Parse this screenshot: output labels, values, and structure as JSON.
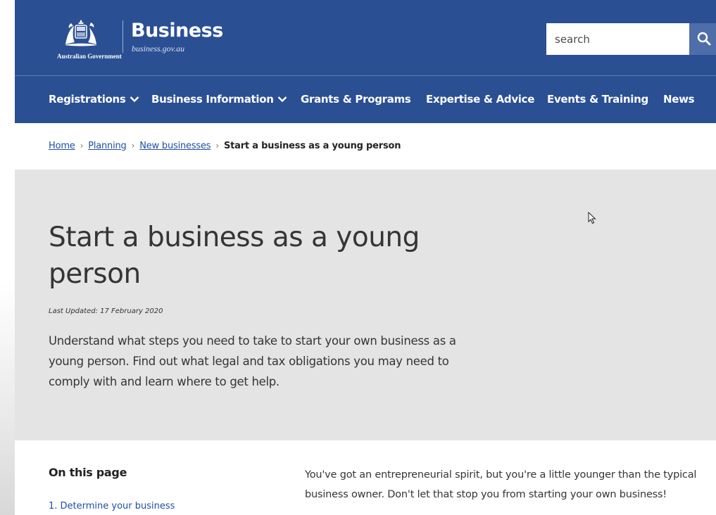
{
  "header": {
    "government_label": "Australian Government",
    "brand_title": "Business",
    "brand_url": "business.gov.au",
    "search_placeholder": "search"
  },
  "nav": {
    "items": [
      {
        "label": "Registrations",
        "dropdown": true
      },
      {
        "label": "Business Information",
        "dropdown": true
      },
      {
        "label": "Grants & Programs",
        "dropdown": false
      },
      {
        "label": "Expertise & Advice",
        "dropdown": false
      },
      {
        "label": "Events & Training",
        "dropdown": false
      },
      {
        "label": "News",
        "dropdown": false
      }
    ]
  },
  "breadcrumb": {
    "items": [
      "Home",
      "Planning",
      "New businesses"
    ],
    "current": "Start a business as a young person",
    "separator": "›"
  },
  "hero": {
    "title": "Start a business as a young person",
    "last_updated": "Last Updated: 17 February 2020",
    "intro": "Understand what steps you need to take to start your own business as a young person. Find out what legal and tax obligations you may need to comply with and learn where to get help."
  },
  "toc": {
    "title": "On this page",
    "items": [
      "1. Determine your business"
    ]
  },
  "body": {
    "paragraph": "You've got an entrepreneurial spirit, but you're a little younger than the typical business owner. Don't let that stop you from starting your own business!"
  },
  "colors": {
    "header_bg": "#2a4f93",
    "search_button_bg": "#4e6ea9",
    "hero_bg": "#e4e4e4",
    "link": "#1f4fa3"
  },
  "icons": {
    "crest": "commonwealth-coat-of-arms-icon",
    "search": "search-icon",
    "dropdown": "chevron-down-icon",
    "cursor": "mouse-pointer-icon"
  }
}
